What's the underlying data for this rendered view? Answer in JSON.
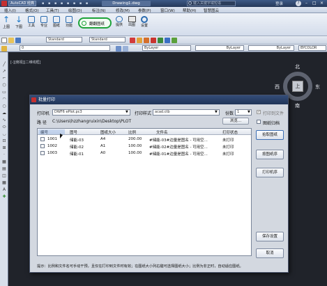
{
  "titlebar": {
    "app_menu": "AutoCAD 经典",
    "doc_title": "Drawing1.dwg",
    "search_placeholder": "键入关键字或短语",
    "signin_label": "登录"
  },
  "menubar": {
    "items": [
      "插入(I)",
      "格式(O)",
      "工具(T)",
      "绘图(D)",
      "标注(N)",
      "修改(M)",
      "参数(P)",
      "窗口(W)",
      "帮助(H)",
      "智慧图云"
    ]
  },
  "ribbon": {
    "buttons": [
      "上图",
      "下图",
      "工具",
      "专业",
      "图纸",
      "功能"
    ],
    "highlight_button": "翻翻图纸",
    "right_buttons": [
      "提供",
      "出图",
      "设置"
    ]
  },
  "toolbars": {
    "style1": "Standard",
    "style2": "Standard",
    "layer_value": "0",
    "bylayer1": "ByLayer",
    "bylayer2": "ByLayer",
    "bylayer3": "ByLayer",
    "bycolor": "BYCOLOR"
  },
  "canvas": {
    "viewport_label": "[-][俯视][二维线框]",
    "compass_n": "北",
    "compass_s": "南",
    "compass_e": "东",
    "compass_w": "西",
    "compass_center": "上"
  },
  "dialog": {
    "title": "批量打印",
    "printer_label": "打印机",
    "printer_value": "DWF6 ePlot.pc3",
    "style_label": "打印样式",
    "style_value": "acad.ctb",
    "copies_label": "份数",
    "copies_value": "1",
    "print_to_file_label": "打印到文件",
    "path_label": "路   径",
    "path_value": "C:\\Users\\hzzhangruixin\\Desktop\\PLOT",
    "browse_label": "浏览...",
    "auto_rotate_label": "图纸归档",
    "table": {
      "headers": [
        "编号",
        "图号",
        "图纸大小",
        "比例",
        "文件名",
        "打印状态"
      ],
      "rows": [
        {
          "num": "1001",
          "fig": "储能-03",
          "size": "A4",
          "scale": "200.00",
          "file": "#储能-03#边量是图名 - 可用空...",
          "status": "未打印"
        },
        {
          "num": "1002",
          "fig": "储能-02",
          "size": "A1",
          "scale": "100.00",
          "file": "#储能-02#边量是图名 - 可用空...",
          "status": "未打印"
        },
        {
          "num": "1003",
          "fig": "储能-01",
          "size": "A0",
          "scale": "100.00",
          "file": "#储能-01#边量是图名 - 可用空...",
          "status": "未打印"
        }
      ]
    },
    "side_buttons": {
      "pick": "拾取图纸",
      "drawing_order": "按图纸序",
      "print_order": "打印机序",
      "save": "保存设置",
      "cancel": "取消"
    },
    "hint": "提示：比例和文件名可手动干预，且仅在打印到文件时有效；在图纸大小列右键可选择图纸大小；比例为非正时，自动适应图纸。"
  },
  "colors": {
    "canvas_bg": "#20232a",
    "dialog_bg": "#d3d8e0",
    "title_bg": "#1f3458",
    "highlight_green": "#1ea33a"
  }
}
